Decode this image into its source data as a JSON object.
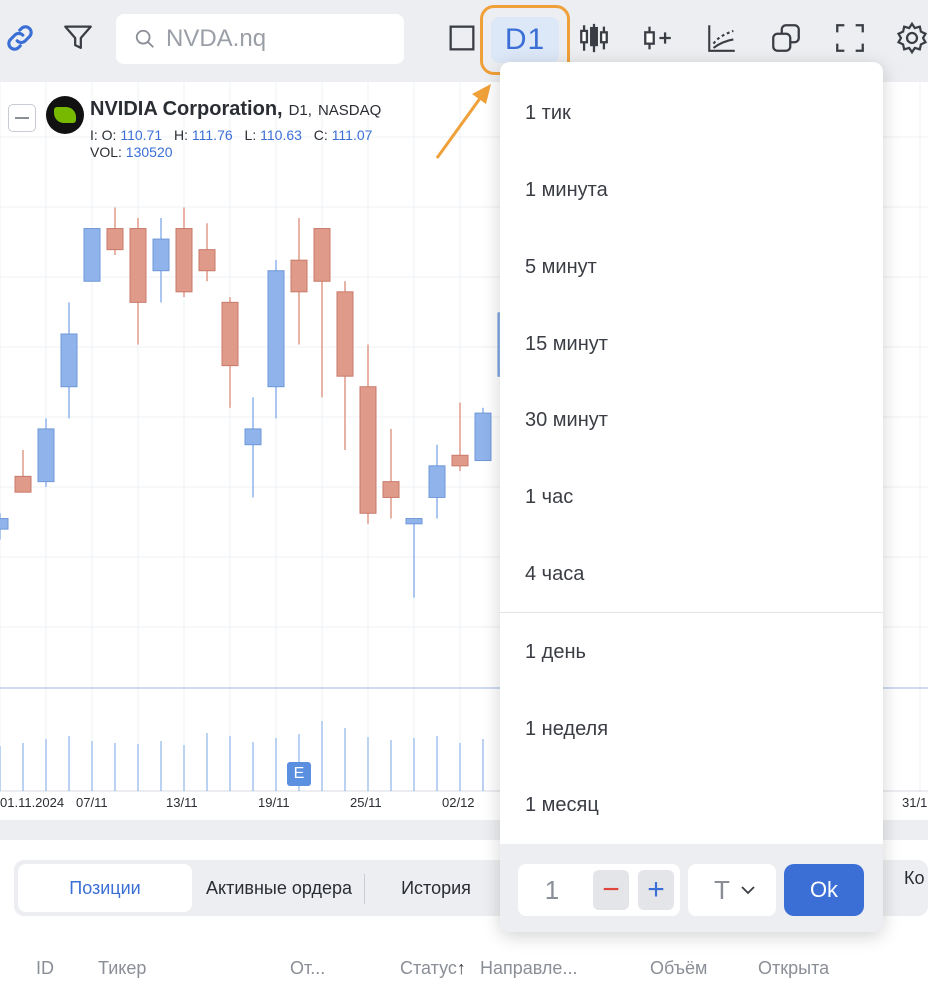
{
  "toolbar": {
    "search_placeholder": "NVDA.nq",
    "timeframe": "D1",
    "icons": [
      "link-icon",
      "filter-icon",
      "search-icon",
      "square-icon",
      "candles-icon",
      "add-indicator-icon",
      "drawing-icon",
      "windows-icon",
      "fullscreen-icon",
      "settings-icon"
    ]
  },
  "legend": {
    "name": "NVIDIA Corporation,",
    "timeframe": "D1,",
    "exchange": "NASDAQ",
    "o_label": "I: O:",
    "o": "110.71",
    "h_label": "H:",
    "h": "111.76",
    "l_label": "L:",
    "l": "110.63",
    "c_label": "C:",
    "c": "111.07",
    "vol_label": "VOL:",
    "vol": "130520"
  },
  "earnings_marker": "E",
  "x_labels": [
    "01.11.2024",
    "07/11",
    "13/11",
    "19/11",
    "25/11",
    "02/12",
    "31/1"
  ],
  "chart_data": {
    "type": "candlestick",
    "colors": {
      "up": "#8fb3ea",
      "down": "#e09a8a"
    },
    "candles": [
      {
        "o": 144.5,
        "h": 146,
        "l": 143.5,
        "c": 145.5
      },
      {
        "o": 149.5,
        "h": 152,
        "l": 148,
        "c": 148
      },
      {
        "o": 149,
        "h": 155,
        "l": 148.5,
        "c": 154
      },
      {
        "o": 158,
        "h": 166,
        "l": 155,
        "c": 163
      },
      {
        "o": 168,
        "h": 173,
        "l": 168,
        "c": 173
      },
      {
        "o": 173,
        "h": 175,
        "l": 170.5,
        "c": 171
      },
      {
        "o": 173,
        "h": 174,
        "l": 162,
        "c": 166
      },
      {
        "o": 169,
        "h": 174,
        "l": 166,
        "c": 172
      },
      {
        "o": 173,
        "h": 175,
        "l": 166.5,
        "c": 167
      },
      {
        "o": 171,
        "h": 173.5,
        "l": 168,
        "c": 169
      },
      {
        "o": 166,
        "h": 166.5,
        "l": 156,
        "c": 160
      },
      {
        "o": 152.5,
        "h": 157,
        "l": 147.5,
        "c": 154
      },
      {
        "o": 158,
        "h": 170,
        "l": 155,
        "c": 169
      },
      {
        "o": 170,
        "h": 174,
        "l": 162,
        "c": 167
      },
      {
        "o": 173,
        "h": 173,
        "l": 157,
        "c": 168
      },
      {
        "o": 167,
        "h": 168,
        "l": 152,
        "c": 159
      },
      {
        "o": 158,
        "h": 162,
        "l": 145,
        "c": 146
      },
      {
        "o": 149,
        "h": 154,
        "l": 145.5,
        "c": 147.5
      },
      {
        "o": 145,
        "h": 145.5,
        "l": 138,
        "c": 145.5
      },
      {
        "o": 147.5,
        "h": 152.5,
        "l": 145.5,
        "c": 150.5
      },
      {
        "o": 151.5,
        "h": 156.5,
        "l": 150,
        "c": 150.5
      },
      {
        "o": 151,
        "h": 156,
        "l": 151,
        "c": 155.5
      },
      {
        "o": 159,
        "h": 166,
        "l": 156,
        "c": 165
      },
      {
        "o": 147,
        "h": 156,
        "l": 144,
        "c": 152.5
      },
      {
        "o": 153,
        "h": 153,
        "l": 143.5,
        "c": 145.5
      }
    ],
    "volumes": [
      45,
      48,
      52,
      55,
      50,
      48,
      47,
      50,
      46,
      58,
      55,
      49,
      53,
      57,
      70,
      63,
      54,
      51,
      53,
      55,
      48,
      52,
      50,
      48,
      46
    ],
    "y_range": [
      130,
      185
    ],
    "grid": true
  },
  "timeframe_menu": {
    "items": [
      "1 тик",
      "1 минута",
      "5 минут",
      "15 минут",
      "30 минут",
      "1 час",
      "4 часа",
      "1 день",
      "1 неделя",
      "1 месяц"
    ],
    "stepper_value": "1",
    "unit": "T",
    "ok_label": "Ok"
  },
  "bottom": {
    "tabs": [
      "Позиции",
      "Активные ордера",
      "История"
    ],
    "right_tab": "Ко",
    "columns": [
      "ID",
      "Тикер",
      "От...",
      "Статус",
      "Направле...",
      "Объём",
      "Открыта"
    ]
  }
}
